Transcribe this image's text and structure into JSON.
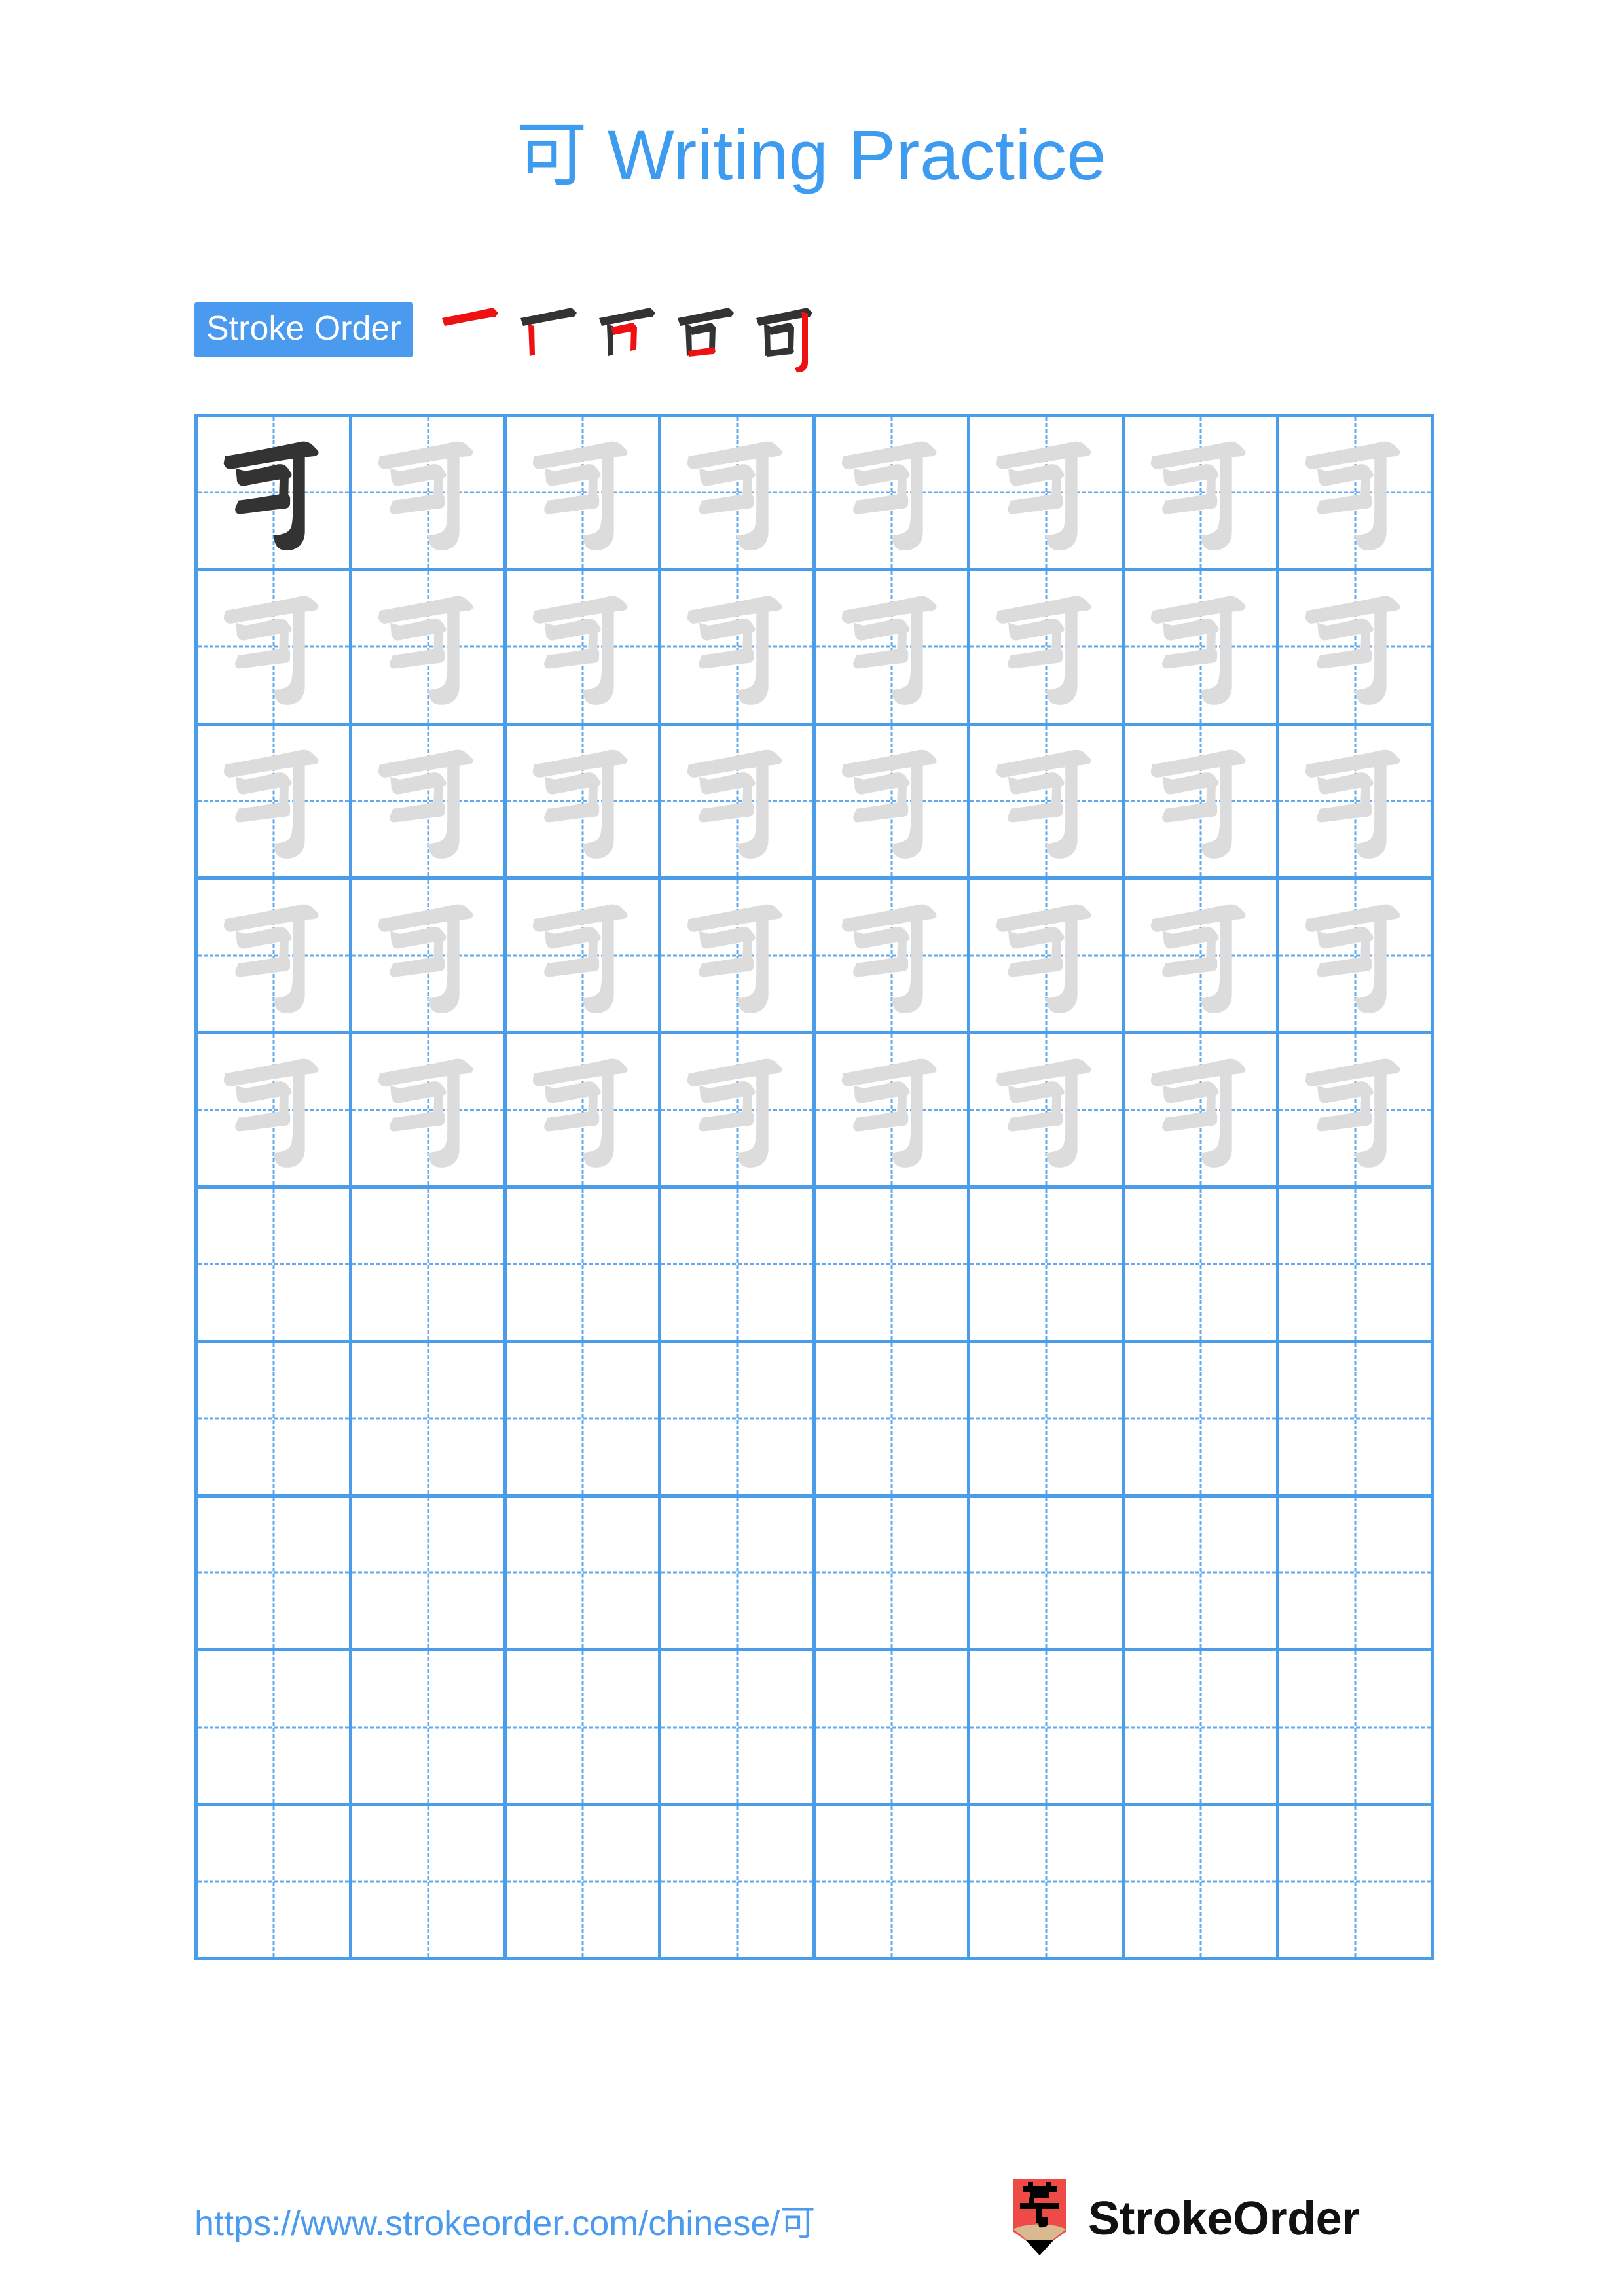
{
  "page": {
    "character": "可",
    "title": "可 Writing Practice",
    "title_suffix": "Writing Practice",
    "background_color": "#ffffff"
  },
  "colors": {
    "accent_blue": "#3d9bf0",
    "badge_blue": "#4a9aef",
    "grid_line_blue": "#4a9de8",
    "grid_dash_blue": "#62a9ed",
    "traced_char_gray": "#dcdcdc",
    "model_char_dark": "#333333",
    "stroke_new_red": "#ee1111",
    "stroke_old_black": "#333333",
    "logo_red": "#ee4a46",
    "logo_wood": "#d9b98f",
    "logo_tip_black": "#000000"
  },
  "stroke_order": {
    "badge_label": "Stroke Order",
    "total_strokes": 5,
    "steps": [
      {
        "index": 1,
        "strokes_shown": 1,
        "new_stroke": "horizontal"
      },
      {
        "index": 2,
        "strokes_shown": 2,
        "new_stroke": "vertical-left"
      },
      {
        "index": 3,
        "strokes_shown": 3,
        "new_stroke": "horizontal-turn-vertical"
      },
      {
        "index": 4,
        "strokes_shown": 4,
        "new_stroke": "horizontal-bottom"
      },
      {
        "index": 5,
        "strokes_shown": 5,
        "new_stroke": "vertical-hook"
      }
    ]
  },
  "grid": {
    "columns": 8,
    "rows": 10,
    "filled_rows": 5,
    "empty_rows": 5,
    "cells": [
      [
        "dark",
        "light",
        "light",
        "light",
        "light",
        "light",
        "light",
        "light"
      ],
      [
        "light",
        "light",
        "light",
        "light",
        "light",
        "light",
        "light",
        "light"
      ],
      [
        "light",
        "light",
        "light",
        "light",
        "light",
        "light",
        "light",
        "light"
      ],
      [
        "light",
        "light",
        "light",
        "light",
        "light",
        "light",
        "light",
        "light"
      ],
      [
        "light",
        "light",
        "light",
        "light",
        "light",
        "light",
        "light",
        "light"
      ],
      [
        "empty",
        "empty",
        "empty",
        "empty",
        "empty",
        "empty",
        "empty",
        "empty"
      ],
      [
        "empty",
        "empty",
        "empty",
        "empty",
        "empty",
        "empty",
        "empty",
        "empty"
      ],
      [
        "empty",
        "empty",
        "empty",
        "empty",
        "empty",
        "empty",
        "empty",
        "empty"
      ],
      [
        "empty",
        "empty",
        "empty",
        "empty",
        "empty",
        "empty",
        "empty",
        "empty"
      ],
      [
        "empty",
        "empty",
        "empty",
        "empty",
        "empty",
        "empty",
        "empty",
        "empty"
      ]
    ]
  },
  "footer": {
    "url": "https://www.strokeorder.com/chinese/可",
    "brand_name": "StrokeOrder",
    "logo_character": "字"
  }
}
